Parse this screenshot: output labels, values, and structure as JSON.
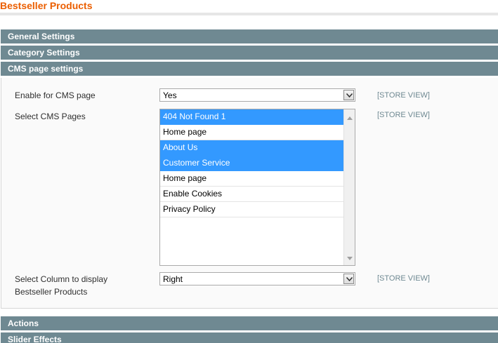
{
  "page": {
    "title": "Bestseller Products"
  },
  "sections": {
    "general": "General Settings",
    "category": "Category Settings",
    "cms": "CMS page settings",
    "actions": "Actions",
    "slider": "Slider Effects"
  },
  "fields": {
    "enable_cms": {
      "label": "Enable for CMS page",
      "value": "Yes",
      "scope": "[STORE VIEW]"
    },
    "cms_pages": {
      "label": "Select CMS Pages",
      "scope": "[STORE VIEW]",
      "options": [
        {
          "label": "404 Not Found 1",
          "selected": true
        },
        {
          "label": "Home page",
          "selected": false
        },
        {
          "label": "About Us",
          "selected": true
        },
        {
          "label": "Customer Service",
          "selected": true
        },
        {
          "label": "Home page",
          "selected": false
        },
        {
          "label": "Enable Cookies",
          "selected": false
        },
        {
          "label": "Privacy Policy",
          "selected": false
        }
      ]
    },
    "column": {
      "label_line1": "Select Column to display",
      "label_line2": "Bestseller Products",
      "value": "Right",
      "scope": "[STORE VIEW]"
    }
  },
  "colors": {
    "title": "#eb5e00",
    "section_header": "#6f8992",
    "selection": "#3399ff",
    "scope": "#6f8992"
  }
}
